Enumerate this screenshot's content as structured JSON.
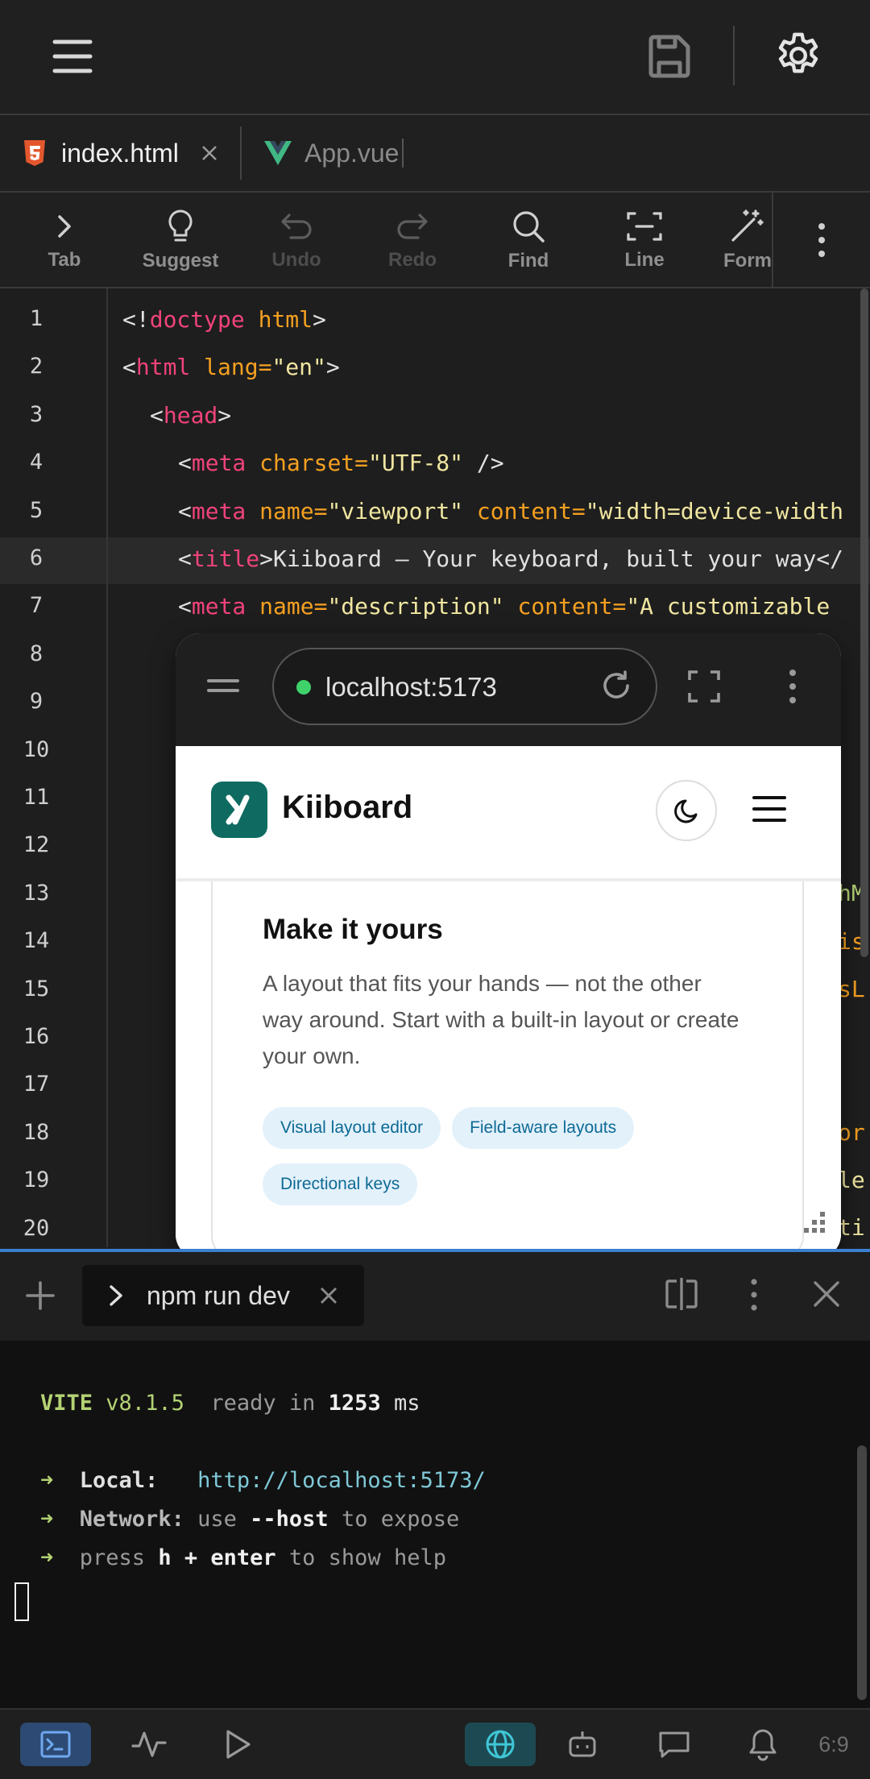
{
  "tabs": [
    {
      "label": "index.html",
      "icon": "html5-icon",
      "active": true
    },
    {
      "label": "App.vue",
      "icon": "vue-icon",
      "active": false
    }
  ],
  "toolbar": [
    {
      "label": "Tab",
      "icon": "chevron-right-icon",
      "disabled": false
    },
    {
      "label": "Suggest",
      "icon": "lightbulb-icon",
      "disabled": false
    },
    {
      "label": "Undo",
      "icon": "undo-icon",
      "disabled": true
    },
    {
      "label": "Redo",
      "icon": "redo-icon",
      "disabled": true
    },
    {
      "label": "Find",
      "icon": "search-icon",
      "disabled": false
    },
    {
      "label": "Line",
      "icon": "line-select-icon",
      "disabled": false
    },
    {
      "label": "Form",
      "icon": "magic-wand-icon",
      "disabled": false
    }
  ],
  "editor": {
    "line_numbers": [
      "1",
      "2",
      "3",
      "4",
      "5",
      "6",
      "7",
      "8",
      "9",
      "10",
      "11",
      "12",
      "13",
      "14",
      "15",
      "16",
      "17",
      "18",
      "19",
      "20"
    ],
    "current_line": 6,
    "code": {
      "l1": {
        "open": "<!",
        "tag": "doctype",
        "sp": " ",
        "attr": "html",
        "close": ">"
      },
      "l2": {
        "open": "<",
        "tag": "html",
        "sp": " ",
        "attr": "lang=",
        "str": "\"en\"",
        "close": ">"
      },
      "l3": {
        "open": "<",
        "tag": "head",
        "close": ">"
      },
      "l4": {
        "open": "<",
        "tag": "meta",
        "sp": " ",
        "attr": "charset=",
        "str": "\"UTF-8\"",
        "close": " />"
      },
      "l5": {
        "open": "<",
        "tag": "meta",
        "sp": " ",
        "attr": "name=",
        "str": "\"viewport\"",
        "sp2": " ",
        "attr2": "content=",
        "str2": "\"width=device-width"
      },
      "l6": {
        "open": "<",
        "tag": "title",
        "text": ">Kiiboard — Your keyboard, built your way</"
      },
      "l7": {
        "open": "<",
        "tag": "meta",
        "sp": " ",
        "attr": "name=",
        "str": "\"description\"",
        "sp2": " ",
        "attr2": "content=",
        "str2": "\"A customizable"
      },
      "right_fragments": {
        "l13": "hM",
        "l14": "is",
        "l15": "sL",
        "l18": "or",
        "l19": "le",
        "l20": "ti"
      }
    }
  },
  "preview": {
    "url": "localhost:5173",
    "site": {
      "brand": "Kiiboard",
      "card_title": "Make it yours",
      "card_text": "A layout that fits your hands — not the other way around. Start with a built-in layout or create your own.",
      "chips": [
        "Visual layout editor",
        "Field-aware layouts",
        "Directional keys"
      ]
    }
  },
  "terminal": {
    "tab_label": "npm run dev",
    "vite": "VITE",
    "version": "v8.1.5",
    "ready_in": "ready in",
    "ready_ms": "1253",
    "ms": "ms",
    "local_label": "Local:",
    "local_url": "http://localhost:5173/",
    "network_label": "Network:",
    "use": "use",
    "host_flag": "--host",
    "to_expose": "to expose",
    "press": "press",
    "h_enter": "h + enter",
    "to_show_help": "to show help"
  },
  "statusbar": {
    "position": "6:9"
  },
  "colors": {
    "accent": "#3b7fd1",
    "vite_green": "#b4d274",
    "tag": "#f0437a",
    "attr": "#f5a021",
    "brand_teal": "#0f6b61"
  }
}
